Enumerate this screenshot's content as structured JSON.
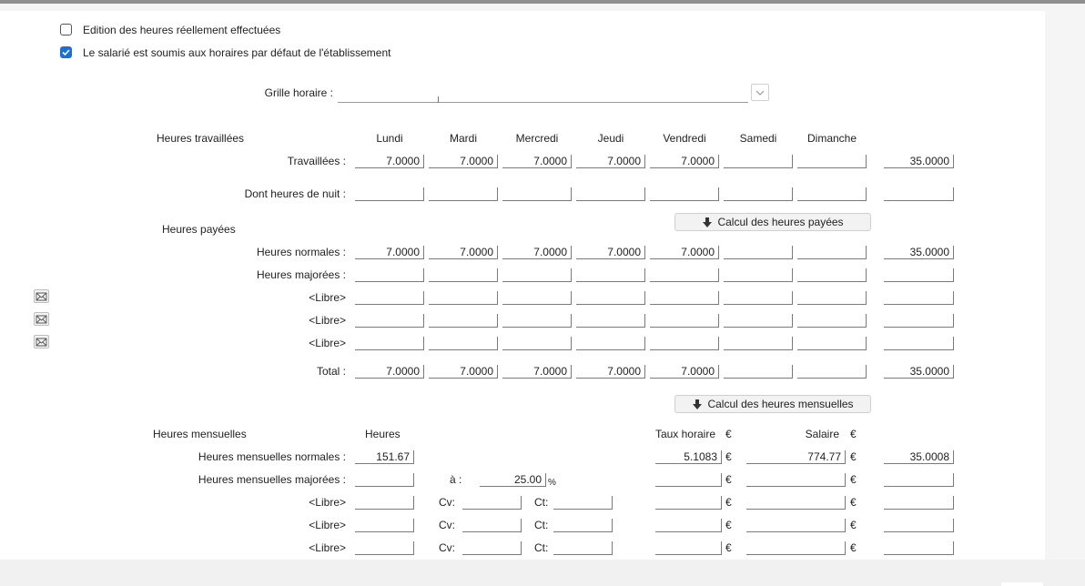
{
  "options": {
    "edition_label": "Edition des heures réellement effectuées",
    "edition_checked": false,
    "default_hours_label": "Le salarié est soumis aux horaires par défaut de l'établissement",
    "default_hours_checked": true
  },
  "grille": {
    "label": "Grille horaire :",
    "value": ""
  },
  "worked": {
    "section": "Heures travaillées",
    "days": [
      "Lundi",
      "Mardi",
      "Mercredi",
      "Jeudi",
      "Vendredi",
      "Samedi",
      "Dimanche"
    ],
    "rows": [
      {
        "label": "Travaillées :",
        "values": [
          "7.0000",
          "7.0000",
          "7.0000",
          "7.0000",
          "7.0000",
          "",
          ""
        ],
        "total": "35.0000"
      },
      {
        "label": "Dont heures de nuit :",
        "values": [
          "",
          "",
          "",
          "",
          "",
          "",
          ""
        ],
        "total": ""
      }
    ]
  },
  "paid": {
    "section": "Heures payées",
    "calc_button": "Calcul des heures payées",
    "rows": [
      {
        "label": "Heures normales :",
        "values": [
          "7.0000",
          "7.0000",
          "7.0000",
          "7.0000",
          "7.0000",
          "",
          ""
        ],
        "total": "35.0000"
      },
      {
        "label": "Heures majorées :",
        "values": [
          "",
          "",
          "",
          "",
          "",
          "",
          ""
        ],
        "total": ""
      },
      {
        "label": "<Libre>",
        "values": [
          "",
          "",
          "",
          "",
          "",
          "",
          ""
        ],
        "total": ""
      },
      {
        "label": "<Libre>",
        "values": [
          "",
          "",
          "",
          "",
          "",
          "",
          ""
        ],
        "total": ""
      },
      {
        "label": "<Libre>",
        "values": [
          "",
          "",
          "",
          "",
          "",
          "",
          ""
        ],
        "total": ""
      }
    ],
    "total_row": {
      "label": "Total :",
      "values": [
        "7.0000",
        "7.0000",
        "7.0000",
        "7.0000",
        "7.0000",
        "",
        ""
      ],
      "total": "35.0000"
    }
  },
  "monthly": {
    "calc_button": "Calcul des heures mensuelles",
    "section": "Heures mensuelles",
    "col_heures": "Heures",
    "col_taux": "Taux horaire",
    "col_salaire": "Salaire",
    "currency": "€",
    "a_label": "à :",
    "percent": "%",
    "cv_label": "Cv:",
    "ct_label": "Ct:",
    "rows": [
      {
        "label": "Heures mensuelles normales :",
        "heures": "151.67",
        "taux": "5.1083",
        "salaire": "774.77",
        "total": "35.0008"
      },
      {
        "label": "Heures mensuelles majorées :",
        "heures": "",
        "pct": "25.00",
        "taux": "",
        "salaire": "",
        "total": ""
      },
      {
        "label": "<Libre>",
        "heures": "",
        "cv": "",
        "ct": "",
        "taux": "",
        "salaire": "",
        "total": ""
      },
      {
        "label": "<Libre>",
        "heures": "",
        "cv": "",
        "ct": "",
        "taux": "",
        "salaire": "",
        "total": ""
      },
      {
        "label": "<Libre>",
        "heures": "",
        "cv": "",
        "ct": "",
        "taux": "",
        "salaire": "",
        "total": ""
      }
    ]
  },
  "icons": {
    "envelope": "envelope-icon",
    "arrow": "arrow-down-icon",
    "chevron": "chevron-down-icon"
  }
}
